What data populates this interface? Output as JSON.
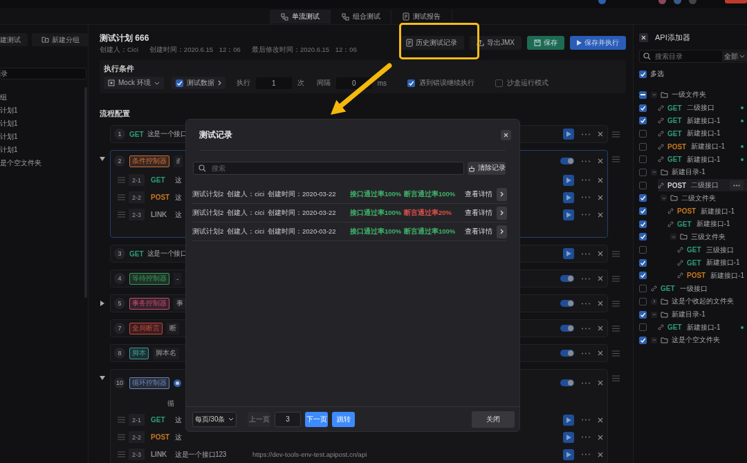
{
  "tabs": [
    {
      "label": "单流测试",
      "selected": true
    },
    {
      "label": "组合测试",
      "selected": false
    },
    {
      "label": "测试报告",
      "selected": false
    }
  ],
  "sidebar": {
    "buttons": [
      "建测试",
      "新建分组"
    ],
    "search_value": "录",
    "items": [
      "组",
      "计划1",
      "计划1",
      "计划1",
      "计划1",
      "是个空文件夹"
    ]
  },
  "plan": {
    "title": "测试计划 666",
    "creator": "创建人：Cici",
    "created": "创建时间：2020.6.15 12：06",
    "modified": "最后修改时间：2020.6.15 12：06",
    "buttons": [
      {
        "label": "历史测试记录",
        "kind": "history"
      },
      {
        "label": "导出JMX",
        "kind": "export"
      },
      {
        "label": "保存",
        "kind": "save"
      },
      {
        "label": "保存并执行",
        "kind": "run"
      }
    ]
  },
  "conditions": {
    "title": "执行条件",
    "environment": "Mock 环境",
    "test_data": {
      "label": "测试数据",
      "checked": true
    },
    "repeat_label": "执行",
    "repeat_value": "1",
    "repeat_unit": "次",
    "interval_label": "间隔",
    "interval_value": "0",
    "interval_unit": "ms",
    "options": [
      {
        "label": "遇到错误继续执行",
        "checked": true
      },
      {
        "label": "沙盒运行模式",
        "checked": false
      }
    ]
  },
  "flow": {
    "title": "流程配置",
    "steps": [
      {
        "number": "1",
        "kind": "api",
        "method": "GET",
        "color": "#2e9c78",
        "name": "这是一个接口",
        "control": {
          "kind": "run"
        },
        "selected": false
      },
      {
        "number": "2",
        "kind": "controller",
        "tag": "条件控制器",
        "color": "#c8703c",
        "value": "if",
        "control": {
          "kind": "toggle",
          "on": true
        },
        "expanded": true,
        "selected": true,
        "children": [
          {
            "number": "2-1",
            "method": "GET",
            "color": "#2e9c78",
            "name": "这",
            "control": {
              "kind": "run"
            }
          },
          {
            "number": "2-2",
            "method": "POST",
            "color": "#c8781e",
            "name": "这",
            "control": {
              "kind": "run"
            }
          },
          {
            "number": "2-3",
            "method": "LINK",
            "color": "#8a8a8e",
            "name": "这",
            "control": {
              "kind": "run"
            }
          }
        ]
      },
      {
        "number": "3",
        "kind": "api",
        "method": "GET",
        "color": "#2e9c78",
        "name": "这是一个接口",
        "control": {
          "kind": "run"
        },
        "selected": false
      },
      {
        "number": "4",
        "kind": "controller",
        "tag": "等待控制器",
        "color": "#3d9a5c",
        "value": "-",
        "control": {
          "kind": "toggle",
          "on": true
        },
        "selected": false
      },
      {
        "number": "5",
        "kind": "controller",
        "tag": "事务控制器",
        "color": "#c0506e",
        "value": "事",
        "control": {
          "kind": "toggle",
          "on": true
        },
        "expanded": false,
        "selected": false
      },
      {
        "number": "7",
        "kind": "controller",
        "tag": "全局断言",
        "color": "#c8463c",
        "value": "断",
        "control": {
          "kind": "toggle",
          "on": true
        },
        "selected": false
      },
      {
        "number": "8",
        "kind": "controller",
        "tag": "脚本",
        "color": "#3a9a95",
        "value": "脚本名",
        "control": {
          "kind": "toggle",
          "on": true
        },
        "selected": false
      },
      {
        "number": "10",
        "kind": "loop",
        "tag": "循环控制器",
        "color": "#6d86b8",
        "radio_selected": true,
        "note": "循",
        "control": {
          "kind": "toggle",
          "on": true
        },
        "expanded": true,
        "selected": false,
        "children": [
          {
            "number": "2-1",
            "method": "GET",
            "color": "#2e9c78",
            "name": "这",
            "control": {
              "kind": "run"
            }
          },
          {
            "number": "2-2",
            "method": "POST",
            "color": "#c8781e",
            "name": "这",
            "control": {
              "kind": "run"
            }
          },
          {
            "number": "2-3",
            "method": "LINK",
            "color": "#8a8a8e",
            "name": "这是一个接口123",
            "url": "https://dev-tools-env-test.apipost.cn/api",
            "control": {
              "kind": "run"
            }
          }
        ]
      }
    ]
  },
  "api_panel": {
    "title": "API添加器",
    "search_placeholder": "搜索目录",
    "filter": "全部",
    "multi_select": {
      "label": "多选",
      "checked": true
    },
    "tree": [
      {
        "kind": "folder",
        "label": "一级文件夹",
        "partial": true,
        "expanded": true,
        "highlighted": false,
        "children": [
          {
            "kind": "api",
            "method": "GET",
            "color": "#2e9c78",
            "label": "二级接口",
            "checked": true,
            "dot": true,
            "highlighted": false
          },
          {
            "kind": "api",
            "method": "GET",
            "color": "#2e9c78",
            "label": "新建接口-1",
            "checked": true,
            "dot": true,
            "highlighted": false
          },
          {
            "kind": "api",
            "method": "GET",
            "color": "#2e9c78",
            "label": "新建接口-1",
            "checked": false,
            "dot": false,
            "highlighted": false
          },
          {
            "kind": "api",
            "method": "POST",
            "color": "#c8781e",
            "label": "新建接口-1",
            "checked": false,
            "dot": true,
            "highlighted": false
          },
          {
            "kind": "api",
            "method": "GET",
            "color": "#2e9c78",
            "label": "新建接口-1",
            "checked": false,
            "dot": true,
            "highlighted": false
          }
        ]
      },
      {
        "kind": "folder",
        "label": "新建目录-1",
        "checked": false,
        "partial": false,
        "expanded": true,
        "highlighted": false,
        "children": [
          {
            "kind": "api",
            "method": "POST",
            "color": "#cfcfd2",
            "label": "二级接口",
            "checked": false,
            "dot": false,
            "highlighted": true
          },
          {
            "kind": "folder",
            "label": "二级文件夹",
            "checked": true,
            "partial": false,
            "expanded": true,
            "highlighted": false,
            "children": [
              {
                "kind": "api",
                "method": "POST",
                "color": "#c8781e",
                "label": "新建接口-1",
                "checked": true,
                "dot": false,
                "highlighted": false
              },
              {
                "kind": "api",
                "method": "GET",
                "color": "#2e9c78",
                "label": "新建接口-1",
                "checked": true,
                "dot": false,
                "highlighted": false
              },
              {
                "kind": "folder",
                "label": "三级文件夹",
                "checked": true,
                "partial": false,
                "expanded": true,
                "highlighted": false,
                "children": [
                  {
                    "kind": "api",
                    "method": "GET",
                    "color": "#2e9c78",
                    "label": "三级接口",
                    "checked": false,
                    "dot": false,
                    "highlighted": false
                  },
                  {
                    "kind": "api",
                    "method": "GET",
                    "color": "#2e9c78",
                    "label": "新建接口-1",
                    "checked": true,
                    "dot": false,
                    "highlighted": false
                  },
                  {
                    "kind": "api",
                    "method": "POST",
                    "color": "#c8781e",
                    "label": "新建接口-1",
                    "checked": true,
                    "dot": false,
                    "highlighted": false
                  }
                ]
              }
            ]
          }
        ]
      },
      {
        "kind": "api",
        "method": "GET",
        "color": "#2e9c78",
        "label": "一级接口",
        "checked": false,
        "dot": false,
        "highlighted": false
      },
      {
        "kind": "folder",
        "label": "这是个收起的文件夹",
        "checked": false,
        "partial": false,
        "expanded": false,
        "highlighted": false
      },
      {
        "kind": "folder",
        "label": "新建目录-1",
        "checked": true,
        "partial": false,
        "expanded": true,
        "highlighted": false,
        "children": [
          {
            "kind": "api",
            "method": "GET",
            "color": "#2e9c78",
            "label": "新建接口-1",
            "checked": false,
            "dot": true,
            "highlighted": false
          }
        ]
      },
      {
        "kind": "folder",
        "label": "这是个空文件夹",
        "checked": true,
        "partial": false,
        "expanded": true,
        "highlighted": false
      }
    ]
  },
  "modal": {
    "title": "测试记录",
    "search_placeholder": "搜索",
    "clear_button": "清除记录",
    "records": [
      {
        "plan": "测试计划2",
        "creator": "创建人：cici",
        "created": "创建时间：2020-03-22",
        "api_rate": {
          "text": "接口通过率100%",
          "color": "#3fb56a"
        },
        "assert_rate": {
          "text": "断言通过率100%",
          "color": "#3fb56a"
        },
        "detail": "查看详情"
      },
      {
        "plan": "测试计划2",
        "creator": "创建人：cici",
        "created": "创建时间：2020-03-22",
        "api_rate": {
          "text": "接口通过率100%",
          "color": "#3fb56a"
        },
        "assert_rate": {
          "text": "断言通过率20%",
          "color": "#e0504a"
        },
        "detail": "查看详情"
      },
      {
        "plan": "测试计划2",
        "creator": "创建人：cici",
        "created": "创建时间：2020-03-22",
        "api_rate": {
          "text": "接口通过率100%",
          "color": "#3fb56a"
        },
        "assert_rate": {
          "text": "断言通过率100%",
          "color": "#3fb56a"
        },
        "detail": "查看详情"
      }
    ],
    "page_size": "每页/30条",
    "prev": "上一页",
    "page": "3",
    "next": "下一页",
    "jump": "跳转",
    "close": "关闭"
  }
}
